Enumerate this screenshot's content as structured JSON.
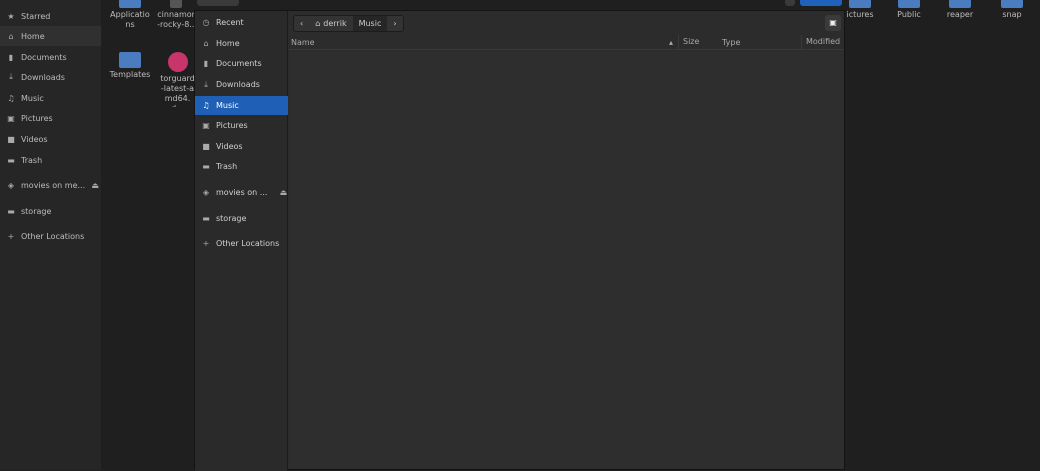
{
  "background": {
    "sidebar": [
      {
        "icon": "star-icon",
        "label": "Starred"
      },
      {
        "icon": "home-icon",
        "label": "Home",
        "selected": true
      },
      {
        "icon": "document-icon",
        "label": "Documents"
      },
      {
        "icon": "download-icon",
        "label": "Downloads"
      },
      {
        "icon": "music-icon",
        "label": "Music"
      },
      {
        "icon": "picture-icon",
        "label": "Pictures"
      },
      {
        "icon": "video-icon",
        "label": "Videos"
      },
      {
        "icon": "trash-icon",
        "label": "Trash"
      },
      {
        "icon": "drive-icon",
        "label": "movies on me..."
      },
      {
        "icon": "folder-icon",
        "label": "storage"
      },
      {
        "icon": "plus-icon",
        "label": "Other Locations"
      }
    ],
    "files": [
      "Applications",
      "cinnamon-rocky-8...",
      "Templates",
      "torguard-latest-amd64.d...",
      "ictures",
      "Public",
      "reaper",
      "snap"
    ]
  },
  "dialog": {
    "sidebar": [
      {
        "icon": "clock-icon",
        "label": "Recent"
      },
      {
        "icon": "home-icon",
        "label": "Home"
      },
      {
        "icon": "document-icon",
        "label": "Documents"
      },
      {
        "icon": "download-icon",
        "label": "Downloads"
      },
      {
        "icon": "music-icon",
        "label": "Music",
        "selected": true
      },
      {
        "icon": "picture-icon",
        "label": "Pictures"
      },
      {
        "icon": "video-icon",
        "label": "Videos"
      },
      {
        "icon": "trash-icon",
        "label": "Trash"
      },
      {
        "icon": "drive-icon",
        "label": "movies on ..."
      },
      {
        "icon": "folder-icon",
        "label": "storage"
      },
      {
        "icon": "plus-icon",
        "label": "Other Locations"
      }
    ],
    "breadcrumb": [
      "derrik",
      "Music"
    ],
    "columns": [
      "Name",
      "Size",
      "Type",
      "Modified"
    ]
  }
}
